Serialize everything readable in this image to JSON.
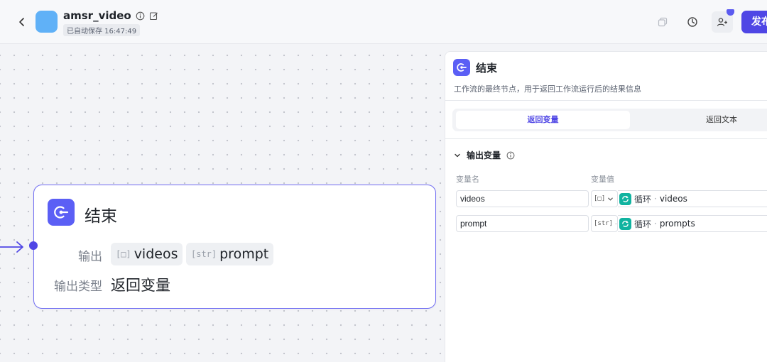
{
  "header": {
    "app_name": "amsr_video",
    "autosave": "已自动保存 16:47:49",
    "publish_label": "发布"
  },
  "node": {
    "title": "结束",
    "output_label": "输出",
    "output_type_label": "输出类型",
    "outputs": [
      {
        "tag": "[□]",
        "name": "videos"
      },
      {
        "tag": "[str]",
        "name": "prompt"
      }
    ],
    "output_type": "返回变量"
  },
  "panel": {
    "title": "结束",
    "description": "工作流的最终节点，用于返回工作流运行后的结果信息",
    "tabs": [
      "返回变量",
      "返回文本"
    ],
    "section_title": "输出变量",
    "col_name": "变量名",
    "col_value": "变量值",
    "rows": [
      {
        "name": "videos",
        "type": "[□]",
        "source": "循环",
        "variable": "videos"
      },
      {
        "name": "prompt",
        "type": "[str]",
        "source": "循环",
        "variable": "prompts"
      }
    ]
  },
  "colors": {
    "accent": "#4f46e5",
    "node_icon": "#5b5ff5",
    "loop_icon": "#10b3a0",
    "app_icon": "#60b1f7"
  }
}
